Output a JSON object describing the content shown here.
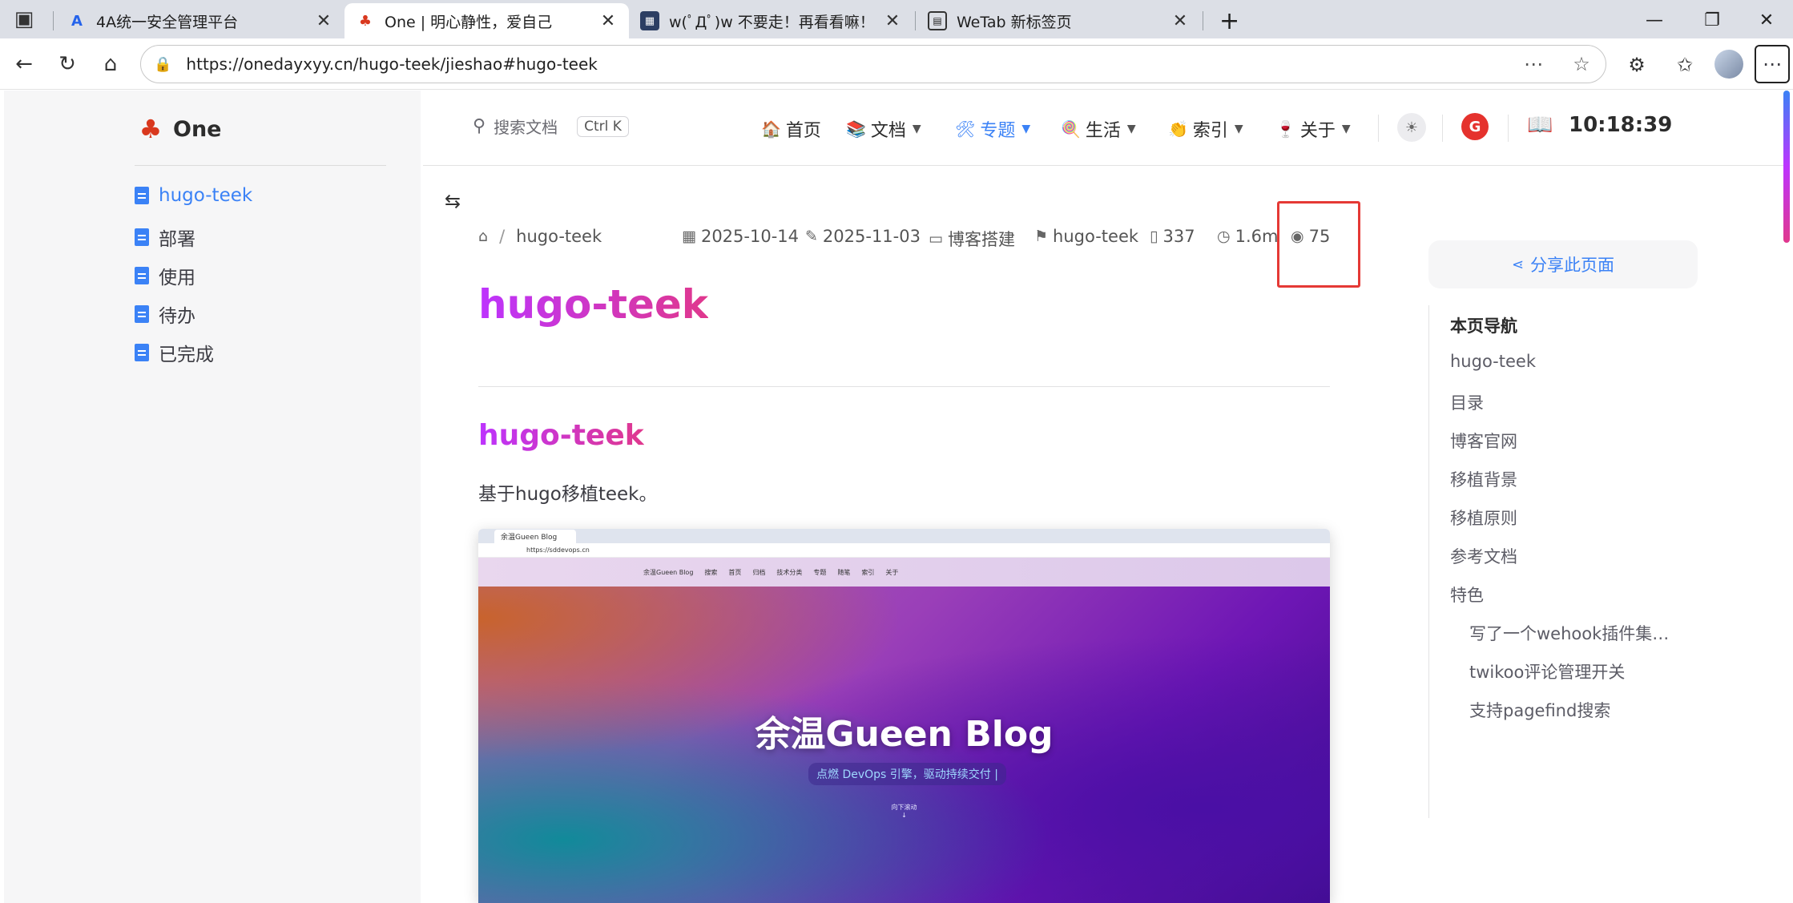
{
  "browser": {
    "tabs": [
      {
        "title": "4A统一安全管理平台",
        "icon": "letter-a-icon"
      },
      {
        "title": "One | 明心静性，爱自己",
        "icon": "tree-icon"
      },
      {
        "title": "w(ﾟДﾟ)w 不要走！再看看嘛！",
        "icon": "image-icon"
      },
      {
        "title": "WeTab 新标签页",
        "icon": "calendar-icon"
      }
    ],
    "new_tab": "+",
    "url": "https://onedayxyy.cn/hugo-teek/jieshao#hugo-teek"
  },
  "site": {
    "logo_text": "One",
    "search_placeholder": "搜索文档",
    "search_shortcut": "Ctrl K",
    "clock": "10:18:39",
    "red_badge": "G",
    "nav": [
      {
        "icon": "🏠",
        "label": "首页"
      },
      {
        "icon": "📚",
        "label": "文档"
      },
      {
        "icon": "🛠",
        "label": "专题"
      },
      {
        "icon": "🍭",
        "label": "生活"
      },
      {
        "icon": "👏",
        "label": "索引"
      },
      {
        "icon": "🍷",
        "label": "关于"
      }
    ]
  },
  "sidebar": {
    "items": [
      {
        "label": "hugo-teek"
      },
      {
        "label": "部署"
      },
      {
        "label": "使用"
      },
      {
        "label": "待办"
      },
      {
        "label": "已完成"
      }
    ]
  },
  "article": {
    "breadcrumb": "hugo-teek",
    "created": "2025-10-14",
    "updated": "2025-11-03",
    "category": "博客搭建",
    "tag": "hugo-teek",
    "words": "337",
    "read_time": "1.6m",
    "views": "75",
    "title": "hugo-teek",
    "h2": "hugo-teek",
    "desc": "基于hugo移植teek。",
    "screenshot": {
      "tab": "余温Gueen Blog",
      "url": "https://sddevops.cn",
      "nav": [
        "余温Gueen Blog",
        "搜索",
        "首页",
        "归档",
        "技术分类",
        "专题",
        "随笔",
        "索引",
        "关于"
      ],
      "title": "余温Gueen Blog",
      "subtitle": "点燃 DevOps 引擎，驱动持续交付 |",
      "scroll_hint": "向下滚动"
    }
  },
  "aside": {
    "share": "分享此页面",
    "toc_title": "本页导航",
    "toc": [
      {
        "label": "hugo-teek",
        "level": 1
      },
      {
        "label": "目录",
        "level": 1
      },
      {
        "label": "博客官网",
        "level": 1
      },
      {
        "label": "移植背景",
        "level": 1
      },
      {
        "label": "移植原则",
        "level": 1
      },
      {
        "label": "参考文档",
        "level": 1
      },
      {
        "label": "特色",
        "level": 1
      },
      {
        "label": "写了一个wehook插件集…",
        "level": 2
      },
      {
        "label": "twikoo评论管理开关",
        "level": 2
      },
      {
        "label": "支持pagefind搜索",
        "level": 2
      }
    ]
  },
  "colors": {
    "accent": "#3b82f6",
    "brand_start": "#bd34fe",
    "brand_end": "#e0388d",
    "highlight": "#e53935"
  }
}
